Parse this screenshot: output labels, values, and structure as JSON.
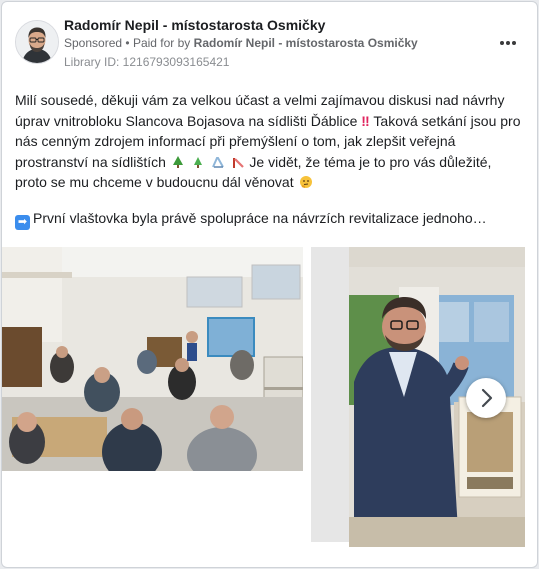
{
  "post": {
    "page_name": "Radomír Nepil - místostarosta Osmičky",
    "sponsored_label": "Sponsored",
    "paid_for_prefix": "Paid for by",
    "paid_for_name": "Radomír Nepil - místostarosta Osmičky",
    "library_id": "Library ID: 1216793093165421",
    "body_text_1": "Milí sousedé, děkuji vám za velkou účast a velmi zajímavou diskusi nad návrhy úprav vnitrobloku Slancova Bojasova na sídlišti Ďáblice",
    "body_text_2": "Taková setkání jsou pro nás cenným zdrojem informací při přemýšlení o tom, jak zlepšit veřejná prostranství na sídlištích",
    "body_text_3": "Je vidět, že téma je to pro vás důležité, proto se mu chceme v budoucnu dál věnovat",
    "truncated_text": "První vlaštovka byla právě spolupráce na návrzích revitalizace jednoho…"
  },
  "icons": {
    "more": "more-horizontal-icon",
    "next": "chevron-right-icon",
    "arrow": "right-arrow-emoji",
    "trees": "tree-emoji",
    "slide": "playground-slide-emoji",
    "face": "thinking-face-emoji"
  },
  "colors": {
    "text": "#1c1e21",
    "secondary_text": "#65676b",
    "link_blue": "#3b8ded"
  }
}
